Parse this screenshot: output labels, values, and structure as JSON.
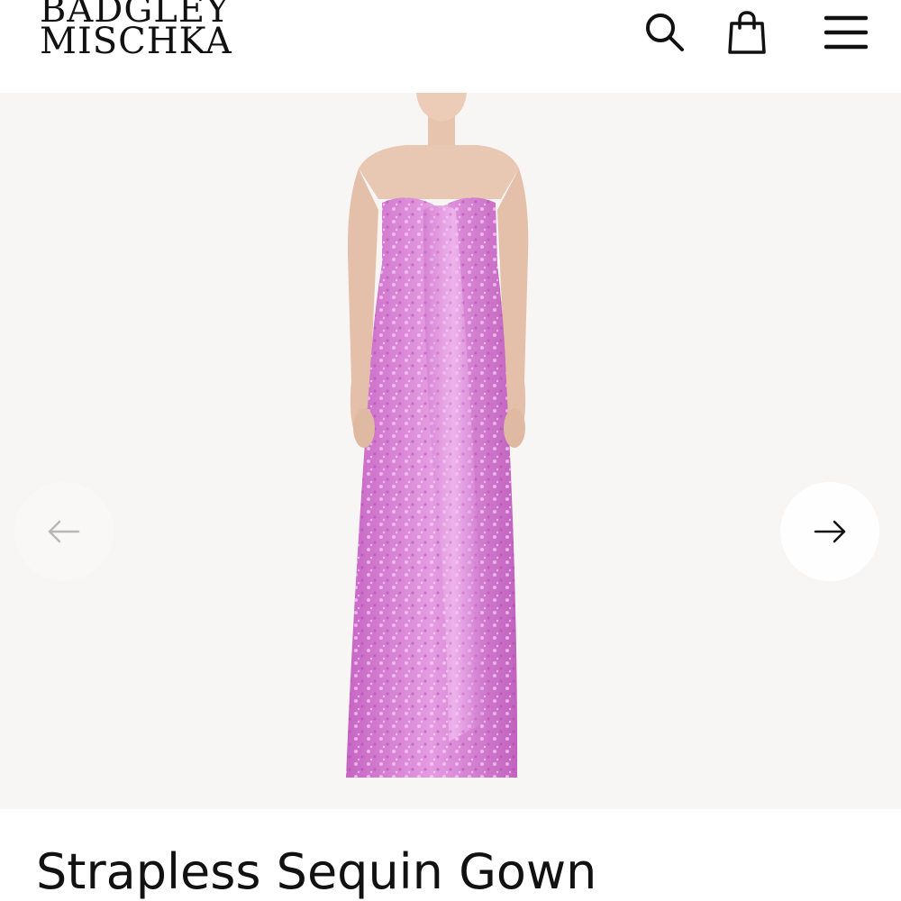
{
  "brand": {
    "line1": "BADGLEY",
    "line2": "MISCHKA"
  },
  "header": {
    "icons": [
      "search-icon",
      "shopping-bag-icon",
      "hamburger-menu-icon"
    ]
  },
  "gallery": {
    "prev_icon": "arrow-left-icon",
    "next_icon": "arrow-right-icon",
    "background_color": "#f8f6f4",
    "dress_color": "#d97fd6"
  },
  "product": {
    "title": "Strapless Sequin Gown"
  }
}
